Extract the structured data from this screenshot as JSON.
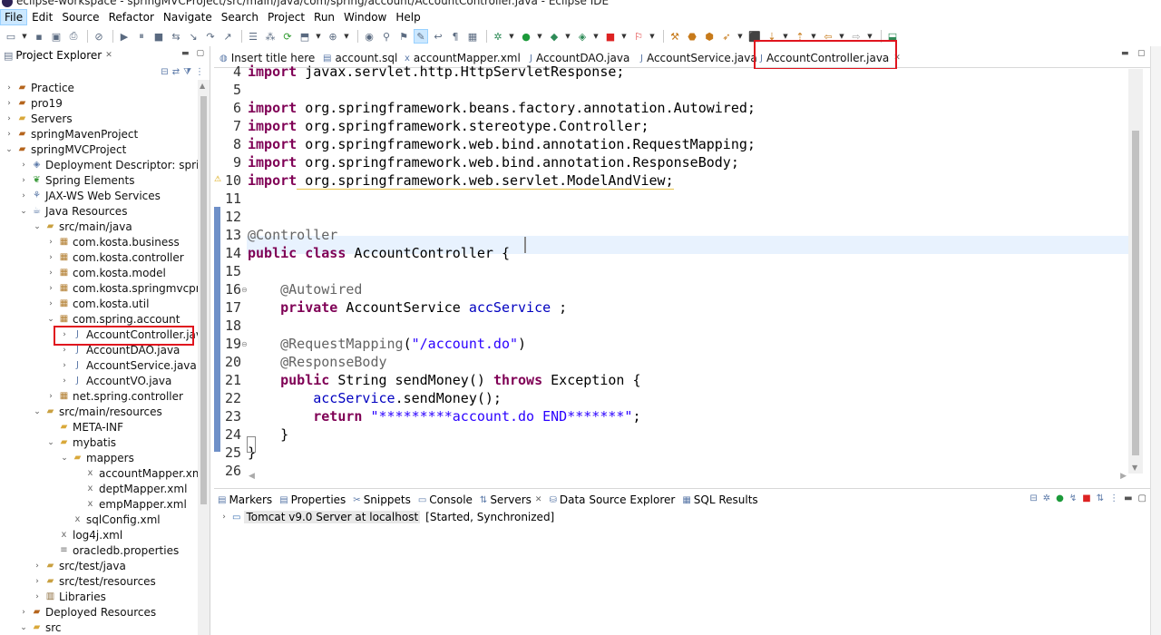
{
  "window": {
    "title": "eclipse-workspace - springMVCProject/src/main/java/com/spring/account/AccountController.java - Eclipse IDE"
  },
  "menu": [
    "File",
    "Edit",
    "Source",
    "Refactor",
    "Navigate",
    "Search",
    "Project",
    "Run",
    "Window",
    "Help"
  ],
  "explorer": {
    "title": "Project Explorer",
    "tree": [
      {
        "label": "Practice",
        "depth": 0,
        "twisty": "collapsed",
        "icon": "project-icon"
      },
      {
        "label": "pro19",
        "depth": 0,
        "twisty": "collapsed",
        "icon": "project-icon"
      },
      {
        "label": "Servers",
        "depth": 0,
        "twisty": "collapsed",
        "icon": "folder-icon"
      },
      {
        "label": "springMavenProject",
        "depth": 0,
        "twisty": "collapsed",
        "icon": "project-icon"
      },
      {
        "label": "springMVCProject",
        "depth": 0,
        "twisty": "expanded",
        "icon": "project-icon"
      },
      {
        "label": "Deployment Descriptor: springMV",
        "depth": 1,
        "twisty": "collapsed",
        "icon": "descriptor-icon"
      },
      {
        "label": "Spring Elements",
        "depth": 1,
        "twisty": "collapsed",
        "icon": "spring-icon"
      },
      {
        "label": "JAX-WS Web Services",
        "depth": 1,
        "twisty": "collapsed",
        "icon": "webservice-icon"
      },
      {
        "label": "Java Resources",
        "depth": 1,
        "twisty": "expanded",
        "icon": "java-resources-icon"
      },
      {
        "label": "src/main/java",
        "depth": 2,
        "twisty": "expanded",
        "icon": "source-folder-icon"
      },
      {
        "label": "com.kosta.business",
        "depth": 3,
        "twisty": "collapsed",
        "icon": "package-icon"
      },
      {
        "label": "com.kosta.controller",
        "depth": 3,
        "twisty": "collapsed",
        "icon": "package-icon"
      },
      {
        "label": "com.kosta.model",
        "depth": 3,
        "twisty": "collapsed",
        "icon": "package-icon"
      },
      {
        "label": "com.kosta.springmvcproject",
        "depth": 3,
        "twisty": "collapsed",
        "icon": "package-icon"
      },
      {
        "label": "com.kosta.util",
        "depth": 3,
        "twisty": "collapsed",
        "icon": "package-icon"
      },
      {
        "label": "com.spring.account",
        "depth": 3,
        "twisty": "expanded",
        "icon": "package-icon"
      },
      {
        "label": "AccountController.java",
        "depth": 4,
        "twisty": "collapsed",
        "icon": "java-file-icon",
        "highlighted": true
      },
      {
        "label": "AccountDAO.java",
        "depth": 4,
        "twisty": "collapsed",
        "icon": "java-file-icon"
      },
      {
        "label": "AccountService.java",
        "depth": 4,
        "twisty": "collapsed",
        "icon": "java-file-icon"
      },
      {
        "label": "AccountVO.java",
        "depth": 4,
        "twisty": "collapsed",
        "icon": "java-file-icon"
      },
      {
        "label": "net.spring.controller",
        "depth": 3,
        "twisty": "collapsed",
        "icon": "package-icon"
      },
      {
        "label": "src/main/resources",
        "depth": 2,
        "twisty": "expanded",
        "icon": "source-folder-icon"
      },
      {
        "label": "META-INF",
        "depth": 3,
        "twisty": "none",
        "icon": "folder-icon"
      },
      {
        "label": "mybatis",
        "depth": 3,
        "twisty": "expanded",
        "icon": "folder-icon"
      },
      {
        "label": "mappers",
        "depth": 4,
        "twisty": "expanded",
        "icon": "folder-icon"
      },
      {
        "label": "accountMapper.xml",
        "depth": 5,
        "twisty": "none",
        "icon": "xml-file-icon"
      },
      {
        "label": "deptMapper.xml",
        "depth": 5,
        "twisty": "none",
        "icon": "xml-file-icon"
      },
      {
        "label": "empMapper.xml",
        "depth": 5,
        "twisty": "none",
        "icon": "xml-file-icon"
      },
      {
        "label": "sqlConfig.xml",
        "depth": 4,
        "twisty": "none",
        "icon": "xml-file-icon"
      },
      {
        "label": "log4j.xml",
        "depth": 3,
        "twisty": "none",
        "icon": "xml-file-icon"
      },
      {
        "label": "oracledb.properties",
        "depth": 3,
        "twisty": "none",
        "icon": "properties-file-icon"
      },
      {
        "label": "src/test/java",
        "depth": 2,
        "twisty": "collapsed",
        "icon": "source-folder-icon"
      },
      {
        "label": "src/test/resources",
        "depth": 2,
        "twisty": "collapsed",
        "icon": "source-folder-icon"
      },
      {
        "label": "Libraries",
        "depth": 2,
        "twisty": "collapsed",
        "icon": "library-icon"
      },
      {
        "label": "Deployed Resources",
        "depth": 1,
        "twisty": "collapsed",
        "icon": "deployed-icon"
      },
      {
        "label": "src",
        "depth": 1,
        "twisty": "expanded",
        "icon": "folder-icon"
      }
    ]
  },
  "editor": {
    "tabs": [
      {
        "label": "Insert title here",
        "icon": "browser-icon"
      },
      {
        "label": "account.sql",
        "icon": "sql-file-icon"
      },
      {
        "label": "accountMapper.xml",
        "icon": "xml-file-icon"
      },
      {
        "label": "AccountDAO.java",
        "icon": "java-file-icon"
      },
      {
        "label": "AccountService.java",
        "icon": "java-file-icon"
      },
      {
        "label": "AccountController.java",
        "icon": "java-file-icon",
        "active": true
      }
    ],
    "lines": [
      {
        "n": "4",
        "parts": [
          [
            "kw",
            "import"
          ],
          [
            "plain",
            " javax.servlet.http.HttpServletResponse;"
          ]
        ]
      },
      {
        "n": "5",
        "parts": []
      },
      {
        "n": "6",
        "parts": [
          [
            "kw",
            "import"
          ],
          [
            "plain",
            " org.springframework.beans.factory.annotation.Autowired;"
          ]
        ]
      },
      {
        "n": "7",
        "parts": [
          [
            "kw",
            "import"
          ],
          [
            "plain",
            " org.springframework.stereotype.Controller;"
          ]
        ]
      },
      {
        "n": "8",
        "parts": [
          [
            "kw",
            "import"
          ],
          [
            "plain",
            " org.springframework.web.bind.annotation.RequestMapping;"
          ]
        ]
      },
      {
        "n": "9",
        "parts": [
          [
            "kw",
            "import"
          ],
          [
            "plain",
            " org.springframework.web.bind.annotation.ResponseBody;"
          ]
        ]
      },
      {
        "n": "10",
        "parts": [
          [
            "kw",
            "import"
          ],
          [
            "warn",
            " org.springframework.web.servlet.ModelAndView;"
          ]
        ],
        "warning": true
      },
      {
        "n": "11",
        "parts": []
      },
      {
        "n": "12",
        "parts": []
      },
      {
        "n": "13",
        "parts": [
          [
            "ann",
            "@Controller"
          ]
        ]
      },
      {
        "n": "14",
        "parts": [
          [
            "kw",
            "public"
          ],
          [
            "plain",
            " "
          ],
          [
            "kw",
            "class"
          ],
          [
            "plain",
            " AccountController {"
          ]
        ]
      },
      {
        "n": "15",
        "parts": []
      },
      {
        "n": "16",
        "parts": [
          [
            "plain",
            "    "
          ],
          [
            "ann",
            "@Autowired"
          ]
        ],
        "fold": true
      },
      {
        "n": "17",
        "parts": [
          [
            "plain",
            "    "
          ],
          [
            "kw",
            "private"
          ],
          [
            "plain",
            " AccountService "
          ],
          [
            "fld",
            "accService"
          ],
          [
            "plain",
            " ;"
          ]
        ]
      },
      {
        "n": "18",
        "parts": []
      },
      {
        "n": "19",
        "parts": [
          [
            "plain",
            "    "
          ],
          [
            "ann",
            "@RequestMapping"
          ],
          [
            "plain",
            "("
          ],
          [
            "str",
            "\"/account.do\""
          ],
          [
            "plain",
            ")"
          ]
        ],
        "fold": true
      },
      {
        "n": "20",
        "parts": [
          [
            "plain",
            "    "
          ],
          [
            "ann",
            "@ResponseBody"
          ]
        ]
      },
      {
        "n": "21",
        "parts": [
          [
            "plain",
            "    "
          ],
          [
            "kw",
            "public"
          ],
          [
            "plain",
            " String sendMoney() "
          ],
          [
            "kw",
            "throws"
          ],
          [
            "plain",
            " Exception {"
          ]
        ]
      },
      {
        "n": "22",
        "parts": [
          [
            "plain",
            "        "
          ],
          [
            "fld",
            "accService"
          ],
          [
            "plain",
            ".sendMoney();"
          ]
        ]
      },
      {
        "n": "23",
        "parts": [
          [
            "plain",
            "        "
          ],
          [
            "kw",
            "return"
          ],
          [
            "plain",
            " "
          ],
          [
            "str",
            "\"*********account.do END*******\""
          ],
          [
            "plain",
            ";"
          ]
        ]
      },
      {
        "n": "24",
        "parts": [
          [
            "plain",
            "    }"
          ]
        ]
      },
      {
        "n": "25",
        "parts": [
          [
            "plain",
            "}"
          ]
        ]
      },
      {
        "n": "26",
        "parts": []
      }
    ]
  },
  "bottom": {
    "tabs": [
      {
        "label": "Markers",
        "icon": "markers-icon"
      },
      {
        "label": "Properties",
        "icon": "properties-icon"
      },
      {
        "label": "Snippets",
        "icon": "snippets-icon"
      },
      {
        "label": "Console",
        "icon": "console-icon"
      },
      {
        "label": "Servers",
        "icon": "servers-icon",
        "active": true
      },
      {
        "label": "Data Source Explorer",
        "icon": "datasource-icon"
      },
      {
        "label": "SQL Results",
        "icon": "sql-results-icon"
      }
    ],
    "server": {
      "name": "Tomcat v9.0 Server at localhost",
      "status": "[Started, Synchronized]"
    }
  },
  "colors": {
    "keyword": "#7f0055",
    "annotation": "#646464",
    "string": "#2a00ff",
    "field": "#0000c0",
    "highlight_box": "#e0141e",
    "change_bar": "#6f90c8"
  }
}
